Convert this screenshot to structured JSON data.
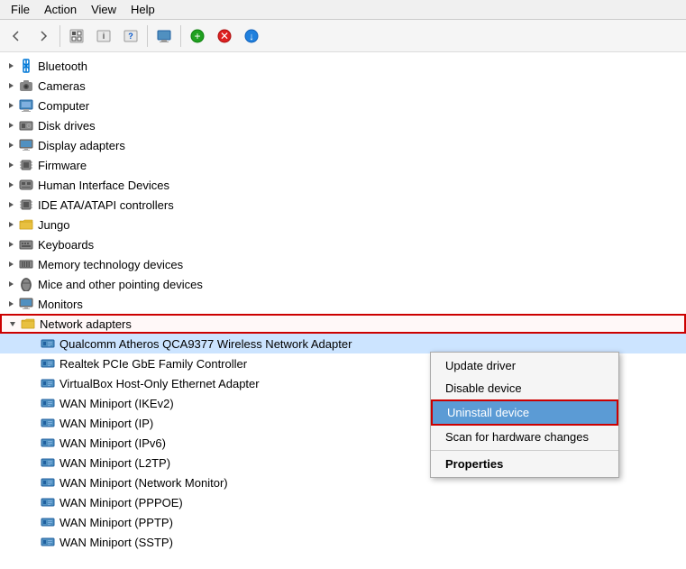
{
  "menubar": {
    "items": [
      "File",
      "Action",
      "View",
      "Help"
    ]
  },
  "toolbar": {
    "buttons": [
      {
        "name": "back",
        "icon": "◄",
        "disabled": false
      },
      {
        "name": "forward",
        "icon": "►",
        "disabled": false
      },
      {
        "name": "up",
        "icon": "▣",
        "disabled": false
      },
      {
        "name": "show-hidden",
        "icon": "▤",
        "disabled": false
      },
      {
        "name": "help",
        "icon": "?",
        "disabled": false
      },
      {
        "name": "sep1",
        "type": "sep"
      },
      {
        "name": "monitor",
        "icon": "▣",
        "disabled": false
      },
      {
        "name": "sep2",
        "type": "sep"
      },
      {
        "name": "add",
        "icon": "✚",
        "disabled": false
      },
      {
        "name": "remove",
        "icon": "✖",
        "disabled": false
      },
      {
        "name": "update",
        "icon": "⬇",
        "disabled": false
      }
    ]
  },
  "tree": {
    "items": [
      {
        "id": "bluetooth",
        "label": "Bluetooth",
        "level": 1,
        "icon": "bluetooth",
        "expandable": true,
        "expanded": false
      },
      {
        "id": "cameras",
        "label": "Cameras",
        "level": 1,
        "icon": "camera",
        "expandable": true,
        "expanded": false
      },
      {
        "id": "computer",
        "label": "Computer",
        "level": 1,
        "icon": "computer",
        "expandable": true,
        "expanded": false
      },
      {
        "id": "disk-drives",
        "label": "Disk drives",
        "level": 1,
        "icon": "disk",
        "expandable": true,
        "expanded": false
      },
      {
        "id": "display-adapters",
        "label": "Display adapters",
        "level": 1,
        "icon": "display",
        "expandable": true,
        "expanded": false
      },
      {
        "id": "firmware",
        "label": "Firmware",
        "level": 1,
        "icon": "chip",
        "expandable": true,
        "expanded": false
      },
      {
        "id": "hid",
        "label": "Human Interface Devices",
        "level": 1,
        "icon": "hid",
        "expandable": true,
        "expanded": false
      },
      {
        "id": "ide",
        "label": "IDE ATA/ATAPI controllers",
        "level": 1,
        "icon": "chip",
        "expandable": true,
        "expanded": false
      },
      {
        "id": "jungo",
        "label": "Jungo",
        "level": 1,
        "icon": "folder",
        "expandable": true,
        "expanded": false
      },
      {
        "id": "keyboards",
        "label": "Keyboards",
        "level": 1,
        "icon": "keyboard",
        "expandable": true,
        "expanded": false
      },
      {
        "id": "memory",
        "label": "Memory technology devices",
        "level": 1,
        "icon": "memory",
        "expandable": true,
        "expanded": false
      },
      {
        "id": "mice",
        "label": "Mice and other pointing devices",
        "level": 1,
        "icon": "mouse",
        "expandable": true,
        "expanded": false
      },
      {
        "id": "monitors",
        "label": "Monitors",
        "level": 1,
        "icon": "monitor",
        "expandable": true,
        "expanded": false
      },
      {
        "id": "network",
        "label": "Network adapters",
        "level": 1,
        "icon": "network-folder",
        "expandable": true,
        "expanded": true,
        "highlighted": true
      },
      {
        "id": "qualcomm",
        "label": "Qualcomm Atheros QCA9377 Wireless Network Adapter",
        "level": 2,
        "icon": "network-card",
        "expandable": false,
        "selected": true,
        "context": true
      },
      {
        "id": "realtek",
        "label": "Realtek PCIe GbE Family Controller",
        "level": 2,
        "icon": "network-card",
        "expandable": false
      },
      {
        "id": "virtualbox",
        "label": "VirtualBox Host-Only Ethernet Adapter",
        "level": 2,
        "icon": "network-card",
        "expandable": false
      },
      {
        "id": "wan-ikev2",
        "label": "WAN Miniport (IKEv2)",
        "level": 2,
        "icon": "network-card",
        "expandable": false
      },
      {
        "id": "wan-ip",
        "label": "WAN Miniport (IP)",
        "level": 2,
        "icon": "network-card",
        "expandable": false
      },
      {
        "id": "wan-ipv6",
        "label": "WAN Miniport (IPv6)",
        "level": 2,
        "icon": "network-card",
        "expandable": false
      },
      {
        "id": "wan-l2tp",
        "label": "WAN Miniport (L2TP)",
        "level": 2,
        "icon": "network-card",
        "expandable": false
      },
      {
        "id": "wan-nm",
        "label": "WAN Miniport (Network Monitor)",
        "level": 2,
        "icon": "network-card",
        "expandable": false
      },
      {
        "id": "wan-pppoe",
        "label": "WAN Miniport (PPPOE)",
        "level": 2,
        "icon": "network-card",
        "expandable": false
      },
      {
        "id": "wan-pptp",
        "label": "WAN Miniport (PPTP)",
        "level": 2,
        "icon": "network-card",
        "expandable": false
      },
      {
        "id": "wan-sstp",
        "label": "WAN Miniport (SSTP)",
        "level": 2,
        "icon": "network-card",
        "expandable": false
      }
    ]
  },
  "contextMenu": {
    "items": [
      {
        "id": "update-driver",
        "label": "Update driver",
        "type": "normal"
      },
      {
        "id": "disable-device",
        "label": "Disable device",
        "type": "normal"
      },
      {
        "id": "uninstall-device",
        "label": "Uninstall device",
        "type": "active",
        "highlighted": true
      },
      {
        "id": "scan-hardware",
        "label": "Scan for hardware changes",
        "type": "normal"
      },
      {
        "id": "sep",
        "type": "sep"
      },
      {
        "id": "properties",
        "label": "Properties",
        "type": "bold"
      }
    ]
  }
}
